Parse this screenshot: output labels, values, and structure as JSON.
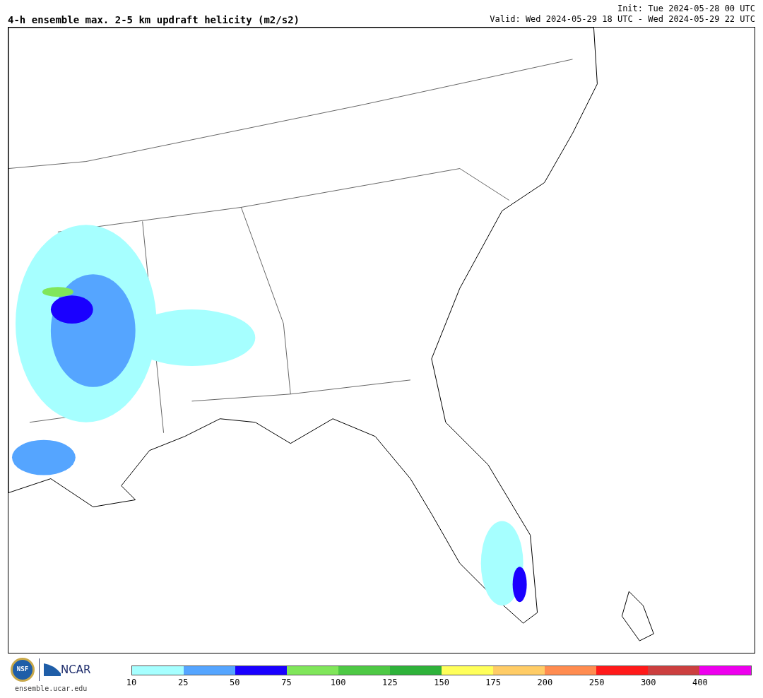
{
  "title": "4-h ensemble max. 2-5 km updraft helicity (m2/s2)",
  "init": "Init: Tue 2024-05-28 00 UTC",
  "valid": "Valid: Wed 2024-05-29 18 UTC - Wed 2024-05-29 22 UTC",
  "logos": {
    "nsf": "NSF",
    "ncar": "NCAR",
    "site": "ensemble.ucar.edu"
  },
  "legend": {
    "bins": [
      {
        "label": "10",
        "color": "#a6ffff"
      },
      {
        "label": "25",
        "color": "#55a5ff"
      },
      {
        "label": "50",
        "color": "#1a00ff"
      },
      {
        "label": "75",
        "color": "#80e65a"
      },
      {
        "label": "100",
        "color": "#4ec945"
      },
      {
        "label": "125",
        "color": "#2eb23a"
      },
      {
        "label": "150",
        "color": "#ffff5a"
      },
      {
        "label": "175",
        "color": "#ffcc66"
      },
      {
        "label": "200",
        "color": "#ff8c50"
      },
      {
        "label": "250",
        "color": "#ff1a1a"
      },
      {
        "label": "300",
        "color": "#cc3f3f"
      },
      {
        "label": "400",
        "color": "#ee00ee"
      }
    ]
  }
}
